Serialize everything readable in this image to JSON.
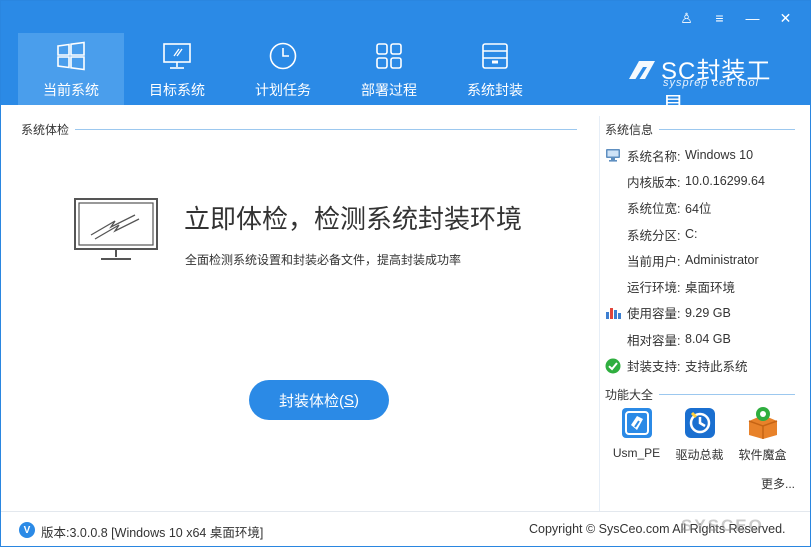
{
  "window": {
    "controls": [
      "user-icon",
      "menu-icon",
      "minimize-icon",
      "close-icon"
    ],
    "control_glyphs": [
      "♙",
      "≡",
      "—",
      "✕"
    ]
  },
  "tabs": [
    {
      "label": "当前系统",
      "icon": "windows-icon",
      "active": true
    },
    {
      "label": "目标系统",
      "icon": "monitor-target-icon",
      "active": false
    },
    {
      "label": "计划任务",
      "icon": "clock-icon",
      "active": false
    },
    {
      "label": "部署过程",
      "icon": "grid-blocks-icon",
      "active": false
    },
    {
      "label": "系统封装",
      "icon": "package-box-icon",
      "active": false
    }
  ],
  "brand": {
    "title": "SC封装工具",
    "subtitle": "sysprep ceo tool"
  },
  "left": {
    "section_title": "系统体检",
    "headline": "立即体检，检测系统封装环境",
    "description": "全面检测系统设置和封装必备文件，提高封装成功率",
    "button_text": "封装体检(",
    "button_hotkey": "S",
    "button_suffix": ")"
  },
  "info": {
    "section_title": "系统信息",
    "rows": [
      {
        "key": "系统名称:",
        "value": "Windows 10",
        "icon": "monitor-icon"
      },
      {
        "key": "内核版本:",
        "value": "10.0.16299.64",
        "icon": ""
      },
      {
        "key": "系统位宽:",
        "value": "64位",
        "icon": ""
      },
      {
        "key": "系统分区:",
        "value": "C:",
        "icon": ""
      },
      {
        "key": "当前用户:",
        "value": "Administrator",
        "icon": ""
      },
      {
        "key": "运行环境:",
        "value": "桌面环境",
        "icon": ""
      },
      {
        "key": "使用容量:",
        "value": "9.29 GB",
        "icon": "bar-chart-icon"
      },
      {
        "key": "相对容量:",
        "value": "8.04 GB",
        "icon": ""
      },
      {
        "key": "封装支持:",
        "value": "支持此系统",
        "icon": "check-circle-icon"
      }
    ]
  },
  "features": {
    "section_title": "功能大全",
    "items": [
      {
        "label": "Usm_PE",
        "icon": "usb-pe-icon"
      },
      {
        "label": "驱动总裁",
        "icon": "driver-tool-icon"
      },
      {
        "label": "软件魔盒",
        "icon": "software-box-icon"
      }
    ],
    "more": "更多..."
  },
  "footer": {
    "version_badge": "V",
    "version": "版本:3.0.0.8 [Windows 10 x64 桌面环境]",
    "copyright": "Copyright © SysCeo.com All Rights Reserved.",
    "watermark": "SYSCEO"
  },
  "colors": {
    "accent": "#2b8ae6",
    "active_tab": "#4a9eec",
    "success": "#2fae3f"
  }
}
